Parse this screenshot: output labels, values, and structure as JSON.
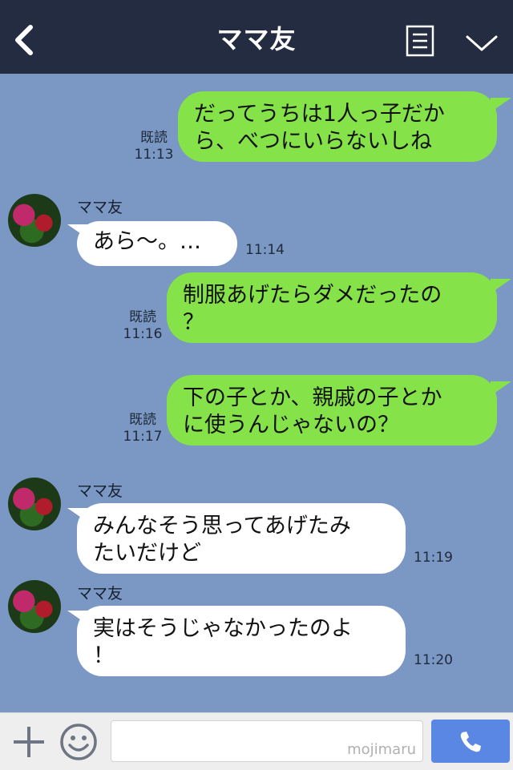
{
  "header": {
    "title": "ママ友"
  },
  "messages": [
    {
      "lines": [
        "だってうちは1人っ子だか",
        "ら、べつにいらないしね"
      ],
      "read": "既読",
      "time": "11:13"
    },
    {
      "sender": "ママ友",
      "lines": [
        "あら〜。…"
      ],
      "time": "11:14"
    },
    {
      "lines": [
        "制服あげたらダメだったの",
        "？"
      ],
      "read": "既読",
      "time": "11:16"
    },
    {
      "lines": [
        "下の子とか、親戚の子とか",
        "に使うんじゃないの？"
      ],
      "read": "既読",
      "time": "11:17"
    },
    {
      "sender": "ママ友",
      "lines": [
        "みんなそう思ってあげたみ",
        "たいだけど"
      ],
      "time": "11:19"
    },
    {
      "sender": "ママ友",
      "lines": [
        "実はそうじゃなかったのよ",
        "！"
      ],
      "time": "11:20"
    }
  ],
  "input": {
    "watermark": "mojimaru"
  },
  "colors": {
    "header": "#232c40",
    "chat_bg": "#7b97c4",
    "my_bubble": "#85e249",
    "their_bubble": "#ffffff",
    "call": "#5a87e3"
  },
  "icons": {
    "back": "chevron-left-icon",
    "menu": "list-icon",
    "collapse": "chevron-down-icon",
    "plus": "plus-icon",
    "emoji": "smile-icon",
    "call": "phone-icon"
  }
}
